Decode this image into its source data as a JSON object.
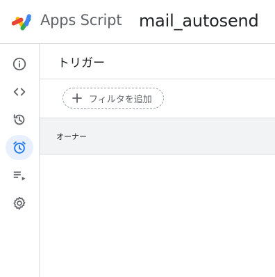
{
  "header": {
    "product_name": "Apps Script",
    "project_title": "mail_autosend",
    "logo_icon": "apps-script-logo-icon"
  },
  "sidebar": {
    "items": [
      {
        "name": "overview",
        "icon": "info-icon",
        "active": false
      },
      {
        "name": "editor",
        "icon": "code-icon",
        "active": false
      },
      {
        "name": "executions",
        "icon": "history-icon",
        "active": false
      },
      {
        "name": "triggers",
        "icon": "alarm-clock-icon",
        "active": true
      },
      {
        "name": "executions-list",
        "icon": "playlist-play-icon",
        "active": false
      },
      {
        "name": "settings",
        "icon": "gear-icon",
        "active": false
      }
    ]
  },
  "main": {
    "title": "トリガー",
    "filter": {
      "label": "フィルタを追加",
      "icon": "plus-icon"
    },
    "table": {
      "columns": [
        "オーナー"
      ]
    }
  },
  "colors": {
    "accent": "#1a73e8",
    "active_bg": "#e8f0fe",
    "divider": "#dadce0",
    "table_header_bg": "#f1f3f4",
    "icon_gray": "#5f6368"
  }
}
